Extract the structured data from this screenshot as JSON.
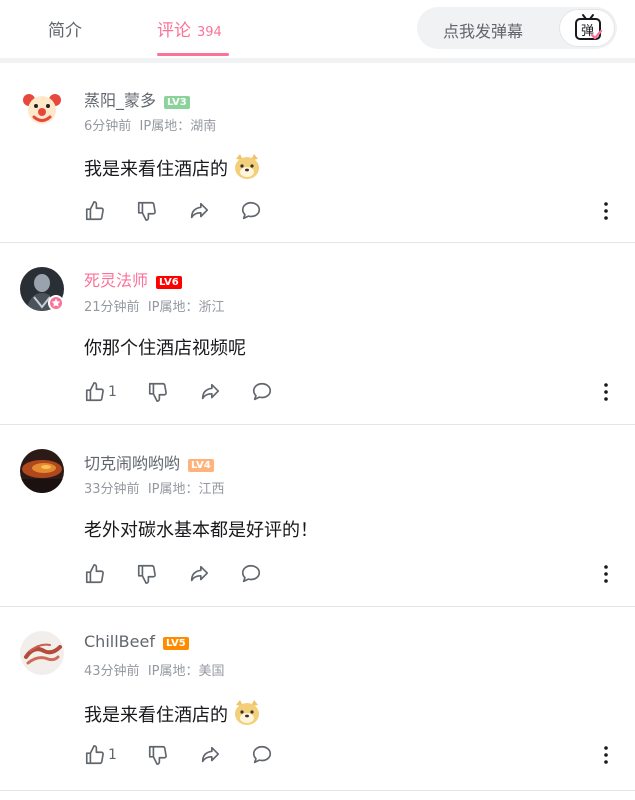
{
  "tabs": {
    "intro_label": "简介",
    "comments_label": "评论",
    "comments_count": "394"
  },
  "danmaku": {
    "placeholder": "点我发弹幕",
    "button_glyph": "弹"
  },
  "colors": {
    "accent": "#fb7299",
    "lv3": "#8bd29b",
    "lv4": "#ffb37c",
    "lv5": "#ff8c00",
    "lv6": "#ff0000"
  },
  "comments": [
    {
      "user": "蒸阳_蒙多",
      "level": "LV3",
      "time": "6分钟前",
      "ip": "IP属地：湖南",
      "text": "我是来看住酒店的",
      "likes": ""
    },
    {
      "user": "死灵法师",
      "level": "LV6",
      "time": "21分钟前",
      "ip": "IP属地：浙江",
      "text": "你那个住酒店视频呢",
      "likes": "1"
    },
    {
      "user": "切克闹哟哟哟",
      "level": "LV4",
      "time": "33分钟前",
      "ip": "IP属地：江西",
      "text": "老外对碳水基本都是好评的！",
      "likes": ""
    },
    {
      "user": "ChillBeef",
      "level": "LV5",
      "time": "43分钟前",
      "ip": "IP属地：美国",
      "text": "我是来看住酒店的",
      "likes": "1"
    }
  ]
}
